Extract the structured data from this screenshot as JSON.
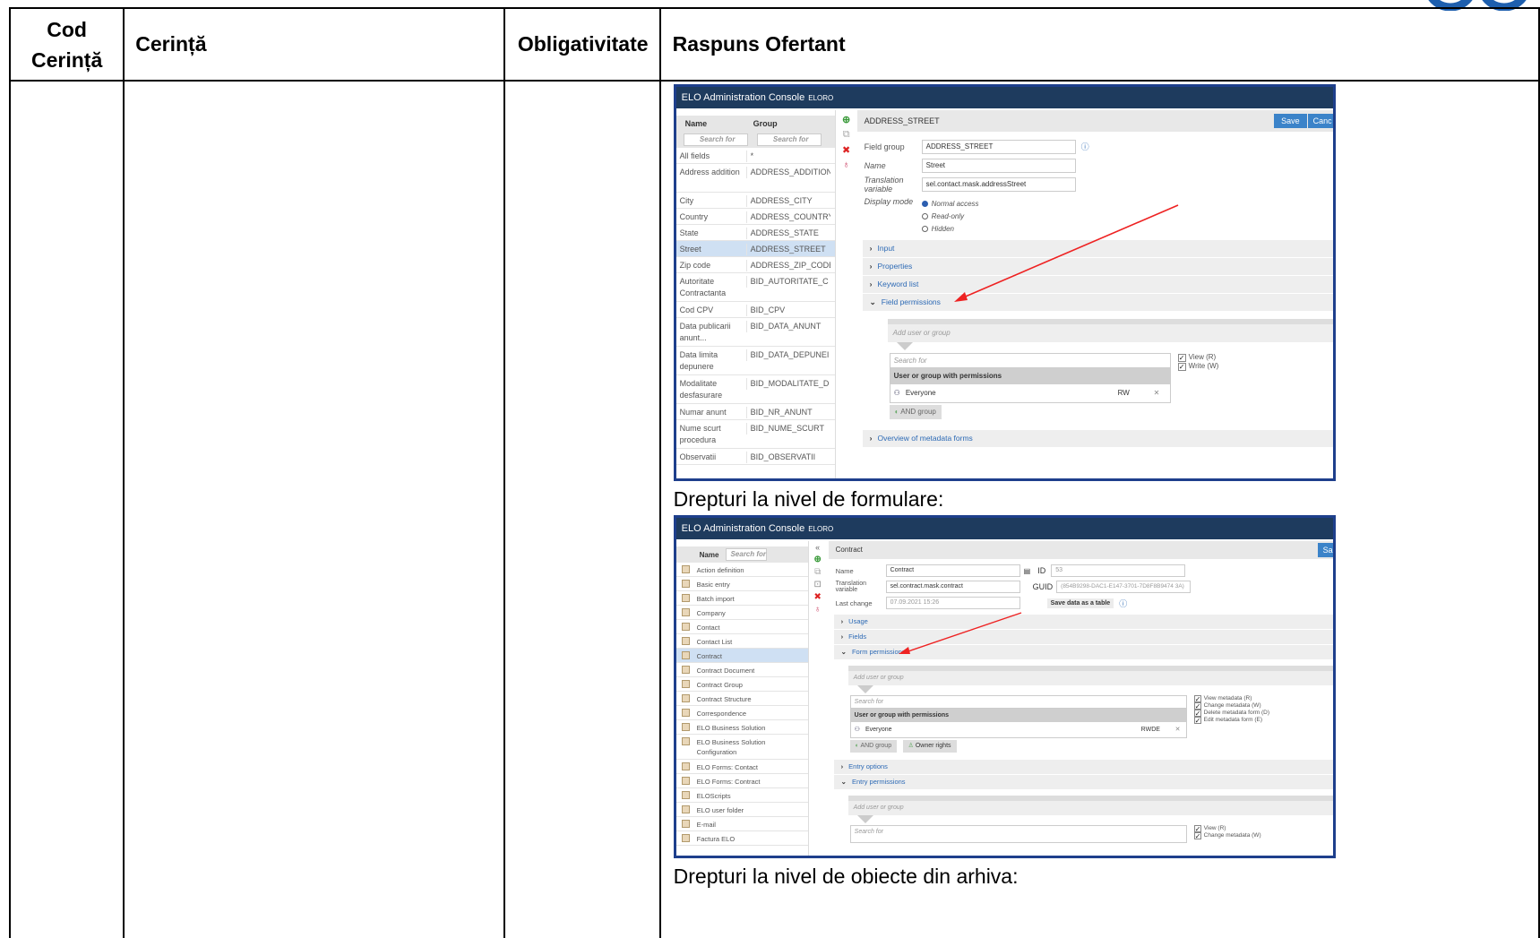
{
  "table": {
    "headers": {
      "code": "Cod Cerință",
      "requirement": "Cerință",
      "mandatory": "Obligativitate",
      "answer": "Raspuns Ofertant"
    },
    "captions": {
      "forms": "Drepturi la nivel de formulare:",
      "objects": "Drepturi la nivel de obiecte din arhiva:"
    }
  },
  "shot1": {
    "title": "ELO Administration Console",
    "subtitle": "ELORO",
    "col_name": "Name",
    "col_group": "Group",
    "search_placeholder": "Search for",
    "rows": [
      {
        "name": "All fields",
        "group": "*"
      },
      {
        "name": "Address addition",
        "group": "ADDRESS_ADDITION"
      },
      {
        "name": "City",
        "group": "ADDRESS_CITY"
      },
      {
        "name": "Country",
        "group": "ADDRESS_COUNTRY"
      },
      {
        "name": "State",
        "group": "ADDRESS_STATE"
      },
      {
        "name": "Street",
        "group": "ADDRESS_STREET"
      },
      {
        "name": "Zip code",
        "group": "ADDRESS_ZIP_CODE"
      },
      {
        "name": "Autoritate Contractanta",
        "group": "BID_AUTORITATE_C"
      },
      {
        "name": "Cod CPV",
        "group": "BID_CPV"
      },
      {
        "name": "Data publicarii anunt...",
        "group": "BID_DATA_ANUNT"
      },
      {
        "name": "Data limita depunere",
        "group": "BID_DATA_DEPUNEI"
      },
      {
        "name": "Modalitate desfasurare",
        "group": "BID_MODALITATE_D"
      },
      {
        "name": "Numar anunt",
        "group": "BID_NR_ANUNT"
      },
      {
        "name": "Nume scurt procedura",
        "group": "BID_NUME_SCURT"
      },
      {
        "name": "Observatii",
        "group": "BID_OBSERVATII"
      }
    ],
    "header": "ADDRESS_STREET",
    "save_label": "Save",
    "cancel_label": "Canc",
    "field_group_label": "Field group",
    "field_group_value": "ADDRESS_STREET",
    "name_label": "Name",
    "name_value": "Street",
    "translation_label": "Translation variable",
    "translation_value": "sel.contact.mask.addressStreet",
    "display_mode_label": "Display mode",
    "display_modes": [
      "Normal access",
      "Read-only",
      "Hidden"
    ],
    "sections": [
      "Input",
      "Properties",
      "Keyword list",
      "Field permissions"
    ],
    "add_user_placeholder": "Add user or group",
    "perm_search": "Search for",
    "perm_header": "User or group with permissions",
    "perm_user": "Everyone",
    "perm_rights": "RW",
    "and_group": "AND group",
    "checks": [
      "View (R)",
      "Write (W)"
    ],
    "overview": "Overview of metadata forms"
  },
  "shot2": {
    "title": "ELO Administration Console",
    "subtitle": "ELORO",
    "col_name": "Name",
    "search_placeholder": "Search for",
    "rows": [
      "Action definition",
      "Basic entry",
      "Batch import",
      "Company",
      "Contact",
      "Contact List",
      "Contract",
      "Contract Document",
      "Contract Group",
      "Contract Structure",
      "Correspondence",
      "ELO Business Solution",
      "ELO Business Solution Configuration",
      "ELO Forms: Contact",
      "ELO Forms: Contract",
      "ELOScripts",
      "ELO user folder",
      "E-mail",
      "Factura ELO"
    ],
    "header": "Contract",
    "save_label": "Sa",
    "name_label": "Name",
    "name_value": "Contract",
    "id_label": "ID",
    "id_value": "53",
    "translation_label": "Translation variable",
    "translation_value": "sel.contract.mask.contract",
    "guid_label": "GUID",
    "guid_value": "(854B9298-DAC1-E147-3701-7D8F8B9474 3A)",
    "last_change_label": "Last change",
    "last_change_value": "07.09.2021 15:26",
    "save_table": "Save data as a table",
    "sections": [
      "Usage",
      "Fields",
      "Form permissions"
    ],
    "add_user_placeholder": "Add user or group",
    "perm_search": "Search for",
    "perm_header": "User or group with permissions",
    "perm_user": "Everyone",
    "perm_rights": "RWDE",
    "and_group": "AND group",
    "owner_rights": "Owner rights",
    "checks": [
      "View metadata (R)",
      "Change metadata (W)",
      "Delete metadata form (D)",
      "Edit metadata form (E)"
    ],
    "sections2": [
      "Entry options",
      "Entry permissions"
    ],
    "add_user_placeholder2": "Add user or group",
    "perm_search2": "Search for",
    "checks2": [
      "View (R)",
      "Change metadata (W)"
    ]
  }
}
